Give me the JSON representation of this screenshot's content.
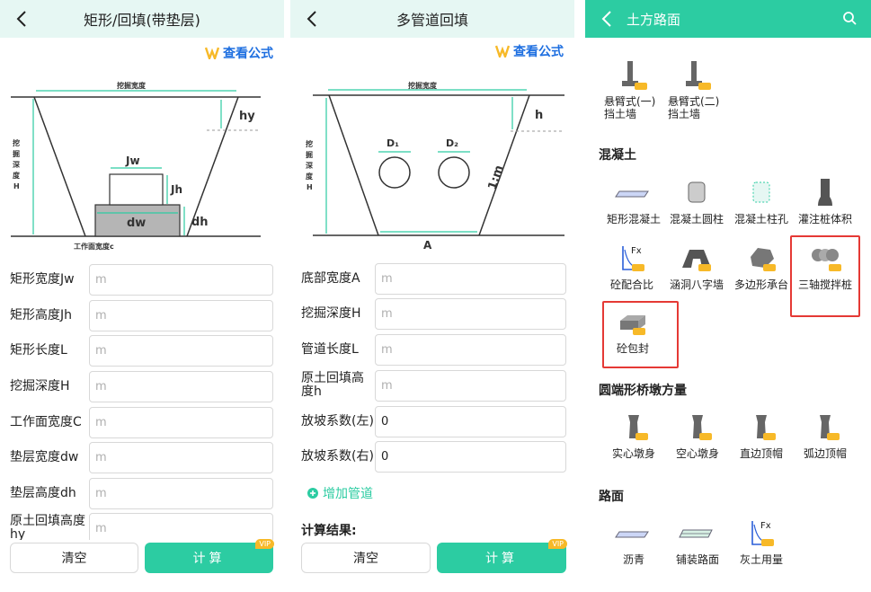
{
  "panel1": {
    "title": "矩形/回填(带垫层)",
    "formula_label": "查看公式",
    "diagram": {
      "dig_width": "挖掘宽度",
      "dig_depth": [
        "挖",
        "掘",
        "深",
        "度",
        "H"
      ],
      "jw": "Jw",
      "jh": "Jh",
      "dw": "dw",
      "dh": "dh",
      "hy": "hy",
      "work_width": "工作面宽度c"
    },
    "fields": [
      {
        "label": "矩形宽度Jw",
        "placeholder": "m",
        "value": ""
      },
      {
        "label": "矩形高度Jh",
        "placeholder": "m",
        "value": ""
      },
      {
        "label": "矩形长度L",
        "placeholder": "m",
        "value": ""
      },
      {
        "label": "挖掘深度H",
        "placeholder": "m",
        "value": ""
      },
      {
        "label": "工作面宽度C",
        "placeholder": "m",
        "value": ""
      },
      {
        "label": "垫层宽度dw",
        "placeholder": "m",
        "value": ""
      },
      {
        "label": "垫层高度dh",
        "placeholder": "m",
        "value": ""
      },
      {
        "label": "原土回填高度hy",
        "placeholder": "m",
        "value": ""
      }
    ],
    "clear_label": "清空",
    "calc_label": "计算",
    "vip": "VIP"
  },
  "panel2": {
    "title": "多管道回填",
    "formula_label": "查看公式",
    "diagram": {
      "dig_width": "挖掘宽度",
      "dig_depth": [
        "挖",
        "掘",
        "深",
        "度",
        "H"
      ],
      "d1": "D₁",
      "d2": "D₂",
      "slope": "1:m",
      "h": "h",
      "a": "A"
    },
    "fields": [
      {
        "label": "底部宽度A",
        "placeholder": "m",
        "value": ""
      },
      {
        "label": "挖掘深度H",
        "placeholder": "m",
        "value": ""
      },
      {
        "label": "管道长度L",
        "placeholder": "m",
        "value": ""
      },
      {
        "label": "原土回填高度h",
        "placeholder": "m",
        "value": ""
      },
      {
        "label": "放坡系数(左)",
        "placeholder": "",
        "value": "0"
      },
      {
        "label": "放坡系数(右)",
        "placeholder": "",
        "value": "0"
      }
    ],
    "add_pipe": "增加管道",
    "result_title": "计算结果:",
    "clear_label": "清空",
    "calc_label": "计算",
    "vip": "VIP"
  },
  "panel3": {
    "title": "土方路面",
    "sections": {
      "retaining": [
        {
          "label": "悬臂式(一)\n挡土墙",
          "icon": "cantilever-wall-icon",
          "vip": true
        },
        {
          "label": "悬臂式(二)\n挡土墙",
          "icon": "cantilever-wall-icon",
          "vip": true
        }
      ],
      "concrete_title": "混凝土",
      "concrete": [
        {
          "label": "矩形混凝土",
          "icon": "slab-icon",
          "vip": false
        },
        {
          "label": "混凝土圆柱",
          "icon": "cylinder-icon",
          "vip": false
        },
        {
          "label": "混凝土柱孔",
          "icon": "column-hole-icon",
          "vip": false
        },
        {
          "label": "灌注桩体积",
          "icon": "pile-icon",
          "vip": false
        },
        {
          "label": "砼配合比",
          "icon": "fx-icon",
          "vip": true
        },
        {
          "label": "涵洞八字墙",
          "icon": "culvert-icon",
          "vip": true
        },
        {
          "label": "多边形承台",
          "icon": "polygon-cap-icon",
          "vip": true
        },
        {
          "label": "三轴搅拌桩",
          "icon": "triple-pile-icon",
          "vip": true
        },
        {
          "label": "砼包封",
          "icon": "encasement-icon",
          "vip": true
        }
      ],
      "pier_title": "圆端形桥墩方量",
      "pier": [
        {
          "label": "实心墩身",
          "icon": "pier-icon",
          "vip": true
        },
        {
          "label": "空心墩身",
          "icon": "pier-icon",
          "vip": true
        },
        {
          "label": "直边顶帽",
          "icon": "pier-icon",
          "vip": true
        },
        {
          "label": "弧边顶帽",
          "icon": "pier-icon",
          "vip": true
        }
      ],
      "road_title": "路面",
      "road": [
        {
          "label": "沥青",
          "icon": "asphalt-icon",
          "vip": false
        },
        {
          "label": "铺装路面",
          "icon": "paving-icon",
          "vip": false
        },
        {
          "label": "灰土用量",
          "icon": "fx-icon",
          "vip": true
        }
      ]
    },
    "accent": "#2ccca2",
    "highlight": "#e53935"
  }
}
